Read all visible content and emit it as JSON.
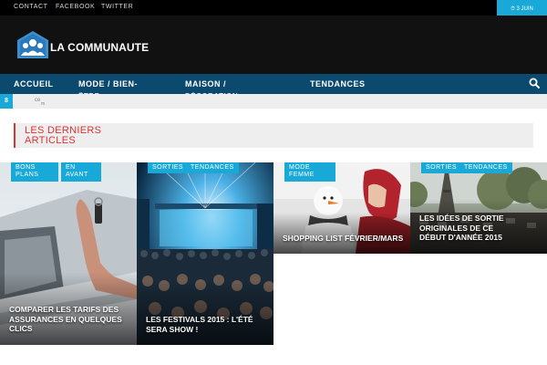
{
  "topbar": {
    "links": [
      "CONTACT",
      "FACEBOOK",
      "TWITTER"
    ],
    "date_line1": "⏱ 3 JUIN",
    "date_line2": "2015"
  },
  "header": {
    "site_name": "LA COMMUNAUTE"
  },
  "nav": {
    "items": [
      "ACCUEIL",
      "MODE / BIEN-",
      "MAISON /",
      "TENDANCES"
    ],
    "subitems": [
      "ÊTRE",
      "DÉCORATION"
    ],
    "search_icon": "search-icon"
  },
  "ticker": {
    "number": "8",
    "fragment1": "ce",
    "fragment2": "m"
  },
  "section": {
    "title": "LES DERNIERS ARTICLES"
  },
  "articles": [
    {
      "tags": [
        "BONS PLANS",
        "EN AVANT"
      ],
      "title": "COMPARER LES TARIFS DES ASSURANCES EN QUELQUES CLICS"
    },
    {
      "tags": [
        "SORTIES",
        "TENDANCES"
      ],
      "title": "LES FESTIVALS 2015 : L'ÉTÉ SERA SHOW !"
    },
    {
      "tags": [
        "MODE FEMME"
      ],
      "title": "SHOPPING LIST FÉVRIER/MARS"
    },
    {
      "tags": [
        "SORTIES",
        "TENDANCES"
      ],
      "title": "LES IDÉES DE SORTIE ORIGINALES DE CE DÉBUT D'ANNÉE 2015"
    }
  ],
  "colors": {
    "accent": "#19a9d8",
    "nav": "#0b4a6e",
    "header": "#111111",
    "section_red": "#dd3333"
  }
}
